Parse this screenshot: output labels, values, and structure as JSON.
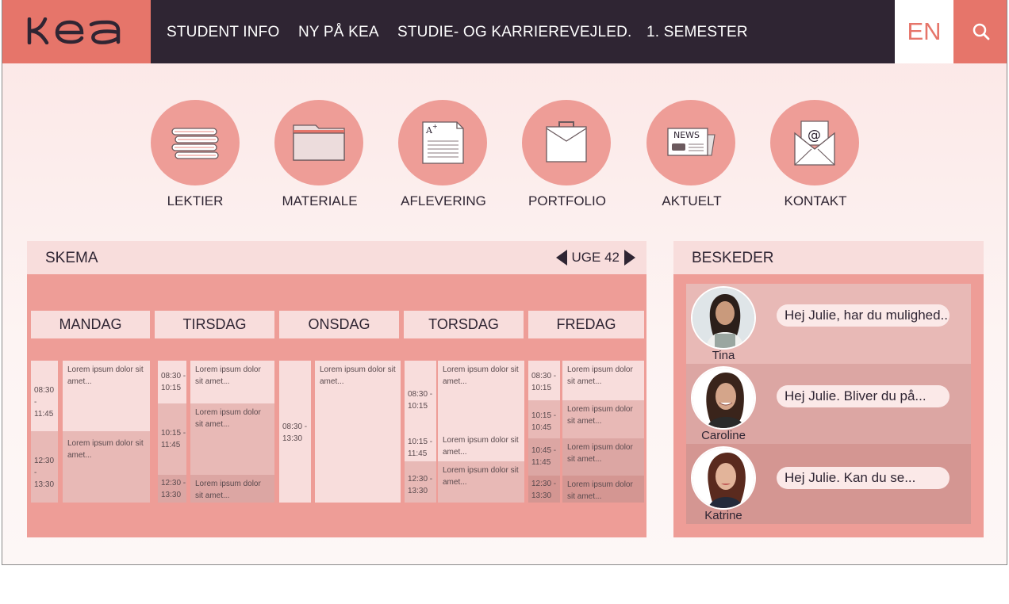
{
  "header": {
    "logo_text": "kea",
    "nav": [
      "STUDENT INFO",
      "NY PÅ KEA",
      "STUDIE- OG KARRIEREVEJLED.",
      "1. SEMESTER"
    ],
    "language": "EN",
    "search_icon": "search-icon"
  },
  "quicklinks": [
    {
      "label": "LEKTIER",
      "icon": "books-icon"
    },
    {
      "label": "MATERIALE",
      "icon": "folder-icon"
    },
    {
      "label": "AFLEVERING",
      "icon": "graded-document-icon"
    },
    {
      "label": "PORTFOLIO",
      "icon": "briefcase-icon"
    },
    {
      "label": "AKTUELT",
      "icon": "newspaper-icon"
    },
    {
      "label": "KONTAKT",
      "icon": "envelope-icon"
    }
  ],
  "news_icon_text": "NEWS",
  "schedule": {
    "title": "SKEMA",
    "week": "UGE 42",
    "days": [
      "MANDAG",
      "TIRSDAG",
      "ONSDAG",
      "TORSDAG",
      "FREDAG"
    ],
    "lorem": "Lorem ipsum dolor sit amet...",
    "times": {
      "t0830_1145": "08:30 - 11:45",
      "t1230_1330": "12:30 - 13:30",
      "t0830_1015": "08:30 - 10:15",
      "t1015_1145": "10:15 - 11:45",
      "t0830_1330": "08:30 - 13:30",
      "t1015_1045": "10:15 - 10:45",
      "t1045_1145": "10:45 - 11:45"
    }
  },
  "messages": {
    "title": "BESKEDER",
    "items": [
      {
        "name": "Tina",
        "preview": "Hej Julie, har du mulighed..."
      },
      {
        "name": "Caroline",
        "preview": "Hej Julie. Bliver du på..."
      },
      {
        "name": "Katrine",
        "preview": "Hej Julie. Kan du se..."
      }
    ]
  },
  "colors": {
    "accent": "#e6756a",
    "dark": "#2f2533",
    "pink_light": "#f8dddc",
    "pink_mid": "#ee9d97"
  }
}
